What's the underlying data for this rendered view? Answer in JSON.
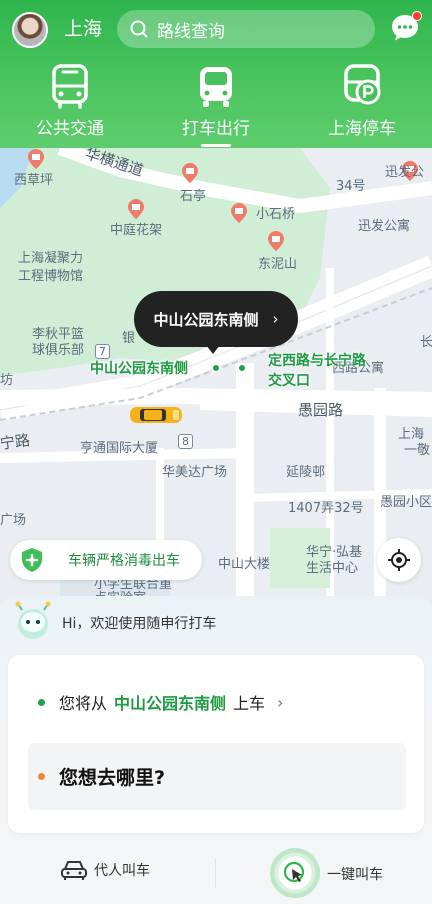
{
  "header": {
    "city": "上海",
    "search_placeholder": "路线查询",
    "tabs": [
      {
        "label": "公共交通",
        "icon": "bus-icon"
      },
      {
        "label": "打车出行",
        "icon": "taxi-icon",
        "active": true
      },
      {
        "label": "上海停车",
        "icon": "parking-icon"
      }
    ]
  },
  "map": {
    "labels": {
      "road_hengtong": "华横通道",
      "xicao": "西草坪",
      "shiting": "石亭",
      "road_34": "34号",
      "xunfa": "迅发公",
      "zhongting": "中庭花架",
      "xiaoshiqiao": "小石桥",
      "xunfa_apt": "迅发公寓",
      "museum_1": "上海凝聚力",
      "museum_2": "工程博物馆",
      "dongnishan": "东泥山",
      "liqiu_1": "李秋平篮",
      "liqiu_2": "球俱乐部",
      "yin": "银",
      "silu": "西路公寓",
      "fang": "坊",
      "chang": "长",
      "ningroad": "宁路",
      "yuyuanroad": "愚园路",
      "shanghai_yi_1": "上海",
      "shanghai_yi_2": "一敬",
      "hengtong": "亨通国际大厦",
      "huameida": "华美达广场",
      "yanlingbang": "延陵邨",
      "lane1407": "1407弄32号",
      "guangchang": "广场",
      "yuyuan_xiao": "愚园小区",
      "zhongshan_tower": "中山大楼",
      "huaning_1": "华宁·弘基",
      "huaning_2": "生活中心",
      "xiaoyuan_1": "小学生联合重",
      "xiaoyuan_2": "点实验室",
      "sign7": "7",
      "sign8": "8"
    },
    "callout": "中山公园东南侧",
    "pickup_label": "中山公园东南侧",
    "cross_label_1": "定西路与长宁路",
    "cross_label_2": "交叉口",
    "disinfect_text": "车辆严格消毒出车"
  },
  "sheet": {
    "greeting": "Hi，欢迎使用随申行打车",
    "pickup_prefix": "您将从",
    "pickup_place": "中山公园东南侧",
    "pickup_suffix": "上车",
    "destination_prompt": "您想去哪里?",
    "proxy_label": "代人叫车",
    "onekey_label": "一键叫车"
  },
  "colors": {
    "brand_green": "#2fb54d",
    "pickup_green": "#1f9a43",
    "dest_orange": "#f0883c"
  }
}
